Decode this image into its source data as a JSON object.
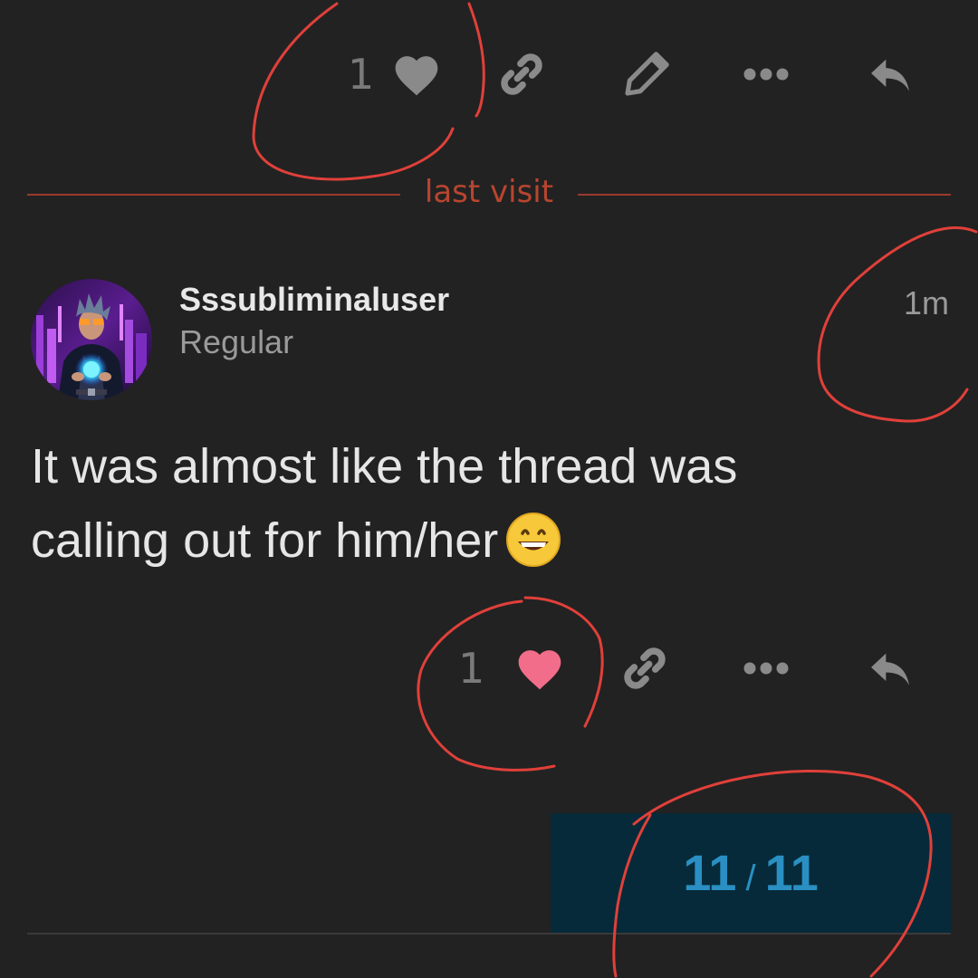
{
  "colors": {
    "background": "#222222",
    "text_primary": "#e6e6e6",
    "text_muted": "#9a9a9a",
    "last_visit": "#b8452f",
    "liked_heart": "#f26d8a",
    "icon_muted": "#8a8a8a",
    "progress_bg": "#062a39",
    "progress_text": "#2a8fc2",
    "annotation_red": "#e0403a"
  },
  "previous_post": {
    "actions": {
      "like_count": "1",
      "like_icon": "heart-icon",
      "link_icon": "link-icon",
      "edit_icon": "pencil-icon",
      "more_icon": "ellipsis-icon",
      "reply_icon": "reply-icon"
    }
  },
  "divider": {
    "label": "last visit"
  },
  "post": {
    "author": {
      "username": "Sssubliminaluser",
      "title": "Regular",
      "avatar": "avatar"
    },
    "time": "1m",
    "body_lines": [
      "It was almost like the thread was",
      "calling out for him/her"
    ],
    "emoji": "grinning-face-emoji",
    "actions": {
      "like_count": "1",
      "like_icon": "heart-icon",
      "link_icon": "link-icon",
      "more_icon": "ellipsis-icon",
      "reply_icon": "reply-icon"
    }
  },
  "progress": {
    "current": "11",
    "separator": "/",
    "total": "11"
  }
}
